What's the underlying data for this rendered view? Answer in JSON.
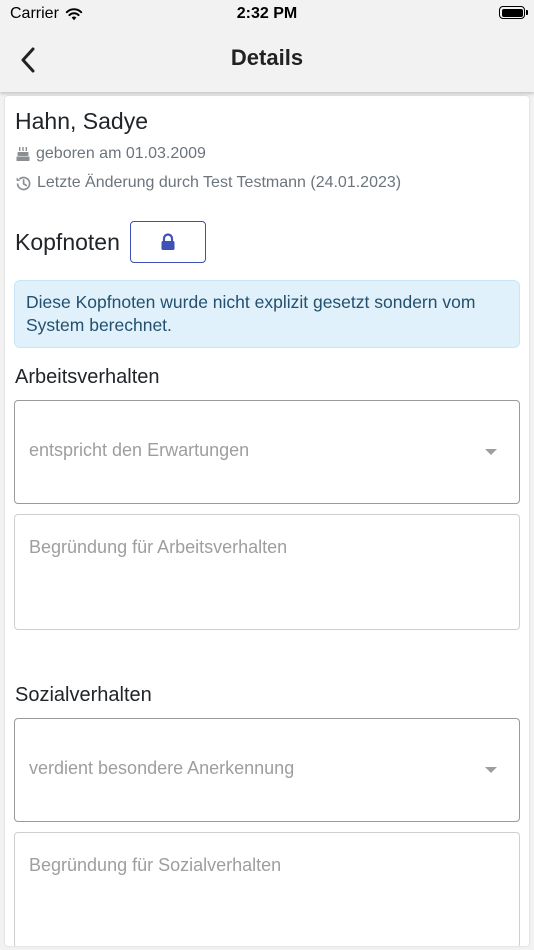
{
  "status_bar": {
    "carrier": "Carrier",
    "time": "2:32 PM"
  },
  "nav": {
    "title": "Details"
  },
  "student": {
    "name": "Hahn, Sadye",
    "birth": "geboren am 01.03.2009",
    "last_change": "Letzte Änderung durch Test Testmann (24.01.2023)"
  },
  "kopfnoten": {
    "title": "Kopfnoten",
    "info": "Diese Kopfnoten wurde nicht explizit gesetzt sondern vom System berechnet."
  },
  "arbeitsverhalten": {
    "label": "Arbeitsverhalten",
    "selected": "entspricht den Erwartungen",
    "reason_placeholder": "Begründung für Arbeitsverhalten"
  },
  "sozialverhalten": {
    "label": "Sozialverhalten",
    "selected": "verdient besondere Anerkennung",
    "reason_placeholder": "Begründung für Sozialverhalten"
  },
  "colors": {
    "accent": "#3f51b5",
    "info_bg": "#e1f1fb",
    "info_text": "#22506e",
    "muted": "#6c757d"
  },
  "icons": {
    "back": "chevron-left-icon",
    "birthday": "birthday-cake-icon",
    "history": "history-icon",
    "lock": "lock-icon",
    "dropdown": "caret-down-icon",
    "wifi": "wifi-icon",
    "battery": "battery-icon"
  }
}
